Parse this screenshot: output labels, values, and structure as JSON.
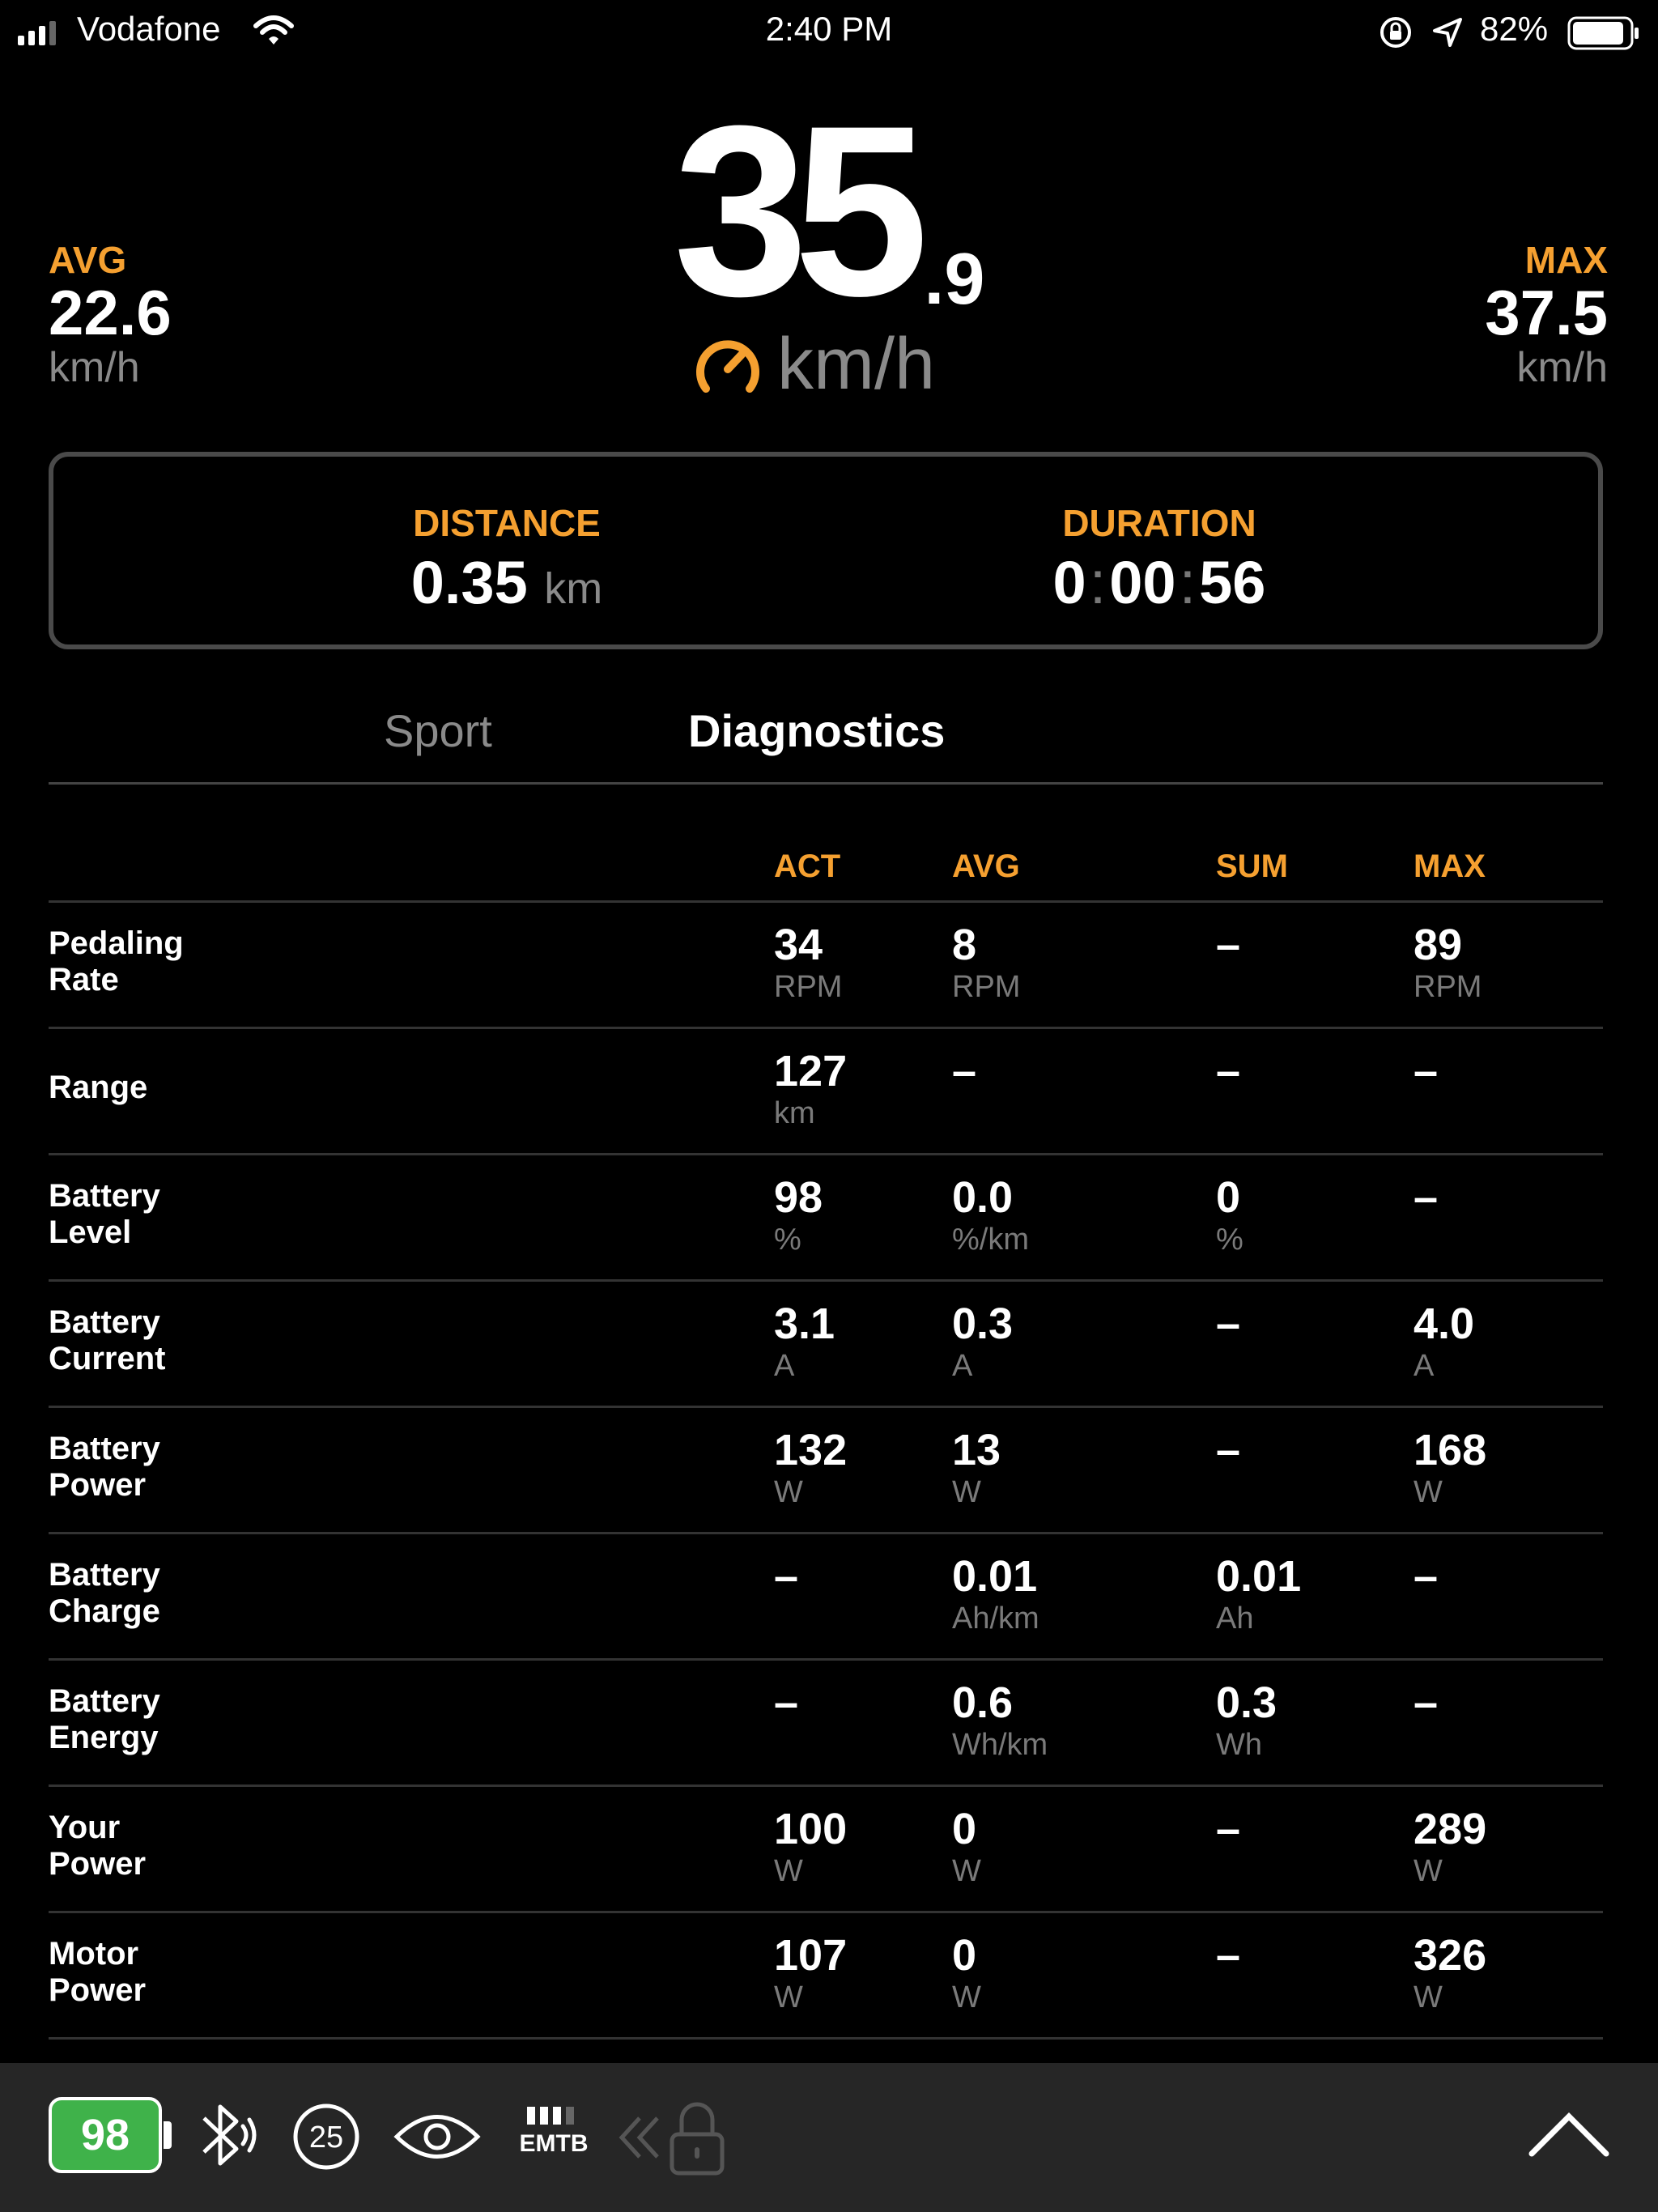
{
  "status_bar": {
    "carrier": "Vodafone",
    "time": "2:40 PM",
    "battery_pct": "82%"
  },
  "speed": {
    "avg_label": "AVG",
    "avg_value": "22.6",
    "avg_unit": "km/h",
    "current_int": "35",
    "current_dec": ".9",
    "current_unit": "km/h",
    "max_label": "MAX",
    "max_value": "37.5",
    "max_unit": "km/h"
  },
  "summary": {
    "distance_label": "DISTANCE",
    "distance_value": "0.35",
    "distance_unit": "km",
    "duration_label": "DURATION",
    "duration_h": "0",
    "duration_m": "00",
    "duration_s": "56",
    "duration_sep": ":"
  },
  "tabs": {
    "sport": "Sport",
    "diagnostics": "Diagnostics",
    "active": "Diagnostics"
  },
  "diagnostics": {
    "headers": {
      "act": "ACT",
      "avg": "AVG",
      "sum": "SUM",
      "max": "MAX"
    },
    "rows": [
      {
        "label1": "Pedaling",
        "label2": "Rate",
        "act": {
          "v": "34",
          "u": "RPM"
        },
        "avg": {
          "v": "8",
          "u": "RPM"
        },
        "sum": {
          "v": "–",
          "u": ""
        },
        "max": {
          "v": "89",
          "u": "RPM"
        }
      },
      {
        "label1": "Range",
        "label2": "",
        "act": {
          "v": "127",
          "u": "km"
        },
        "avg": {
          "v": "–",
          "u": ""
        },
        "sum": {
          "v": "–",
          "u": ""
        },
        "max": {
          "v": "–",
          "u": ""
        }
      },
      {
        "label1": "Battery",
        "label2": "Level",
        "act": {
          "v": "98",
          "u": "%"
        },
        "avg": {
          "v": "0.0",
          "u": "%/km"
        },
        "sum": {
          "v": "0",
          "u": "%"
        },
        "max": {
          "v": "–",
          "u": ""
        }
      },
      {
        "label1": "Battery",
        "label2": "Current",
        "act": {
          "v": "3.1",
          "u": "A"
        },
        "avg": {
          "v": "0.3",
          "u": "A"
        },
        "sum": {
          "v": "–",
          "u": ""
        },
        "max": {
          "v": "4.0",
          "u": "A"
        }
      },
      {
        "label1": "Battery",
        "label2": "Power",
        "act": {
          "v": "132",
          "u": "W"
        },
        "avg": {
          "v": "13",
          "u": "W"
        },
        "sum": {
          "v": "–",
          "u": ""
        },
        "max": {
          "v": "168",
          "u": "W"
        }
      },
      {
        "label1": "Battery",
        "label2": "Charge",
        "act": {
          "v": "–",
          "u": ""
        },
        "avg": {
          "v": "0.01",
          "u": "Ah/km"
        },
        "sum": {
          "v": "0.01",
          "u": "Ah"
        },
        "max": {
          "v": "–",
          "u": ""
        }
      },
      {
        "label1": "Battery",
        "label2": "Energy",
        "act": {
          "v": "–",
          "u": ""
        },
        "avg": {
          "v": "0.6",
          "u": "Wh/km"
        },
        "sum": {
          "v": "0.3",
          "u": "Wh"
        },
        "max": {
          "v": "–",
          "u": ""
        }
      },
      {
        "label1": "Your",
        "label2": "Power",
        "act": {
          "v": "100",
          "u": "W"
        },
        "avg": {
          "v": "0",
          "u": "W"
        },
        "sum": {
          "v": "–",
          "u": ""
        },
        "max": {
          "v": "289",
          "u": "W"
        }
      },
      {
        "label1": "Motor",
        "label2": "Power",
        "act": {
          "v": "107",
          "u": "W"
        },
        "avg": {
          "v": "0",
          "u": "W"
        },
        "sum": {
          "v": "–",
          "u": ""
        },
        "max": {
          "v": "326",
          "u": "W"
        }
      }
    ]
  },
  "bottom_bar": {
    "battery_level": "98",
    "assist_level": "25",
    "mode_label": "EMTB",
    "icons": [
      "battery-icon",
      "bluetooth-icon",
      "assist-level-icon",
      "eye-icon",
      "mode-bars-icon",
      "back-chevrons-icon",
      "lock-icon",
      "chevron-up-icon"
    ]
  },
  "colors": {
    "accent": "#F5A030",
    "background": "#000000",
    "battery_green": "#3fb24a",
    "bar_bg": "#262626",
    "muted": "#8a8a8a"
  }
}
